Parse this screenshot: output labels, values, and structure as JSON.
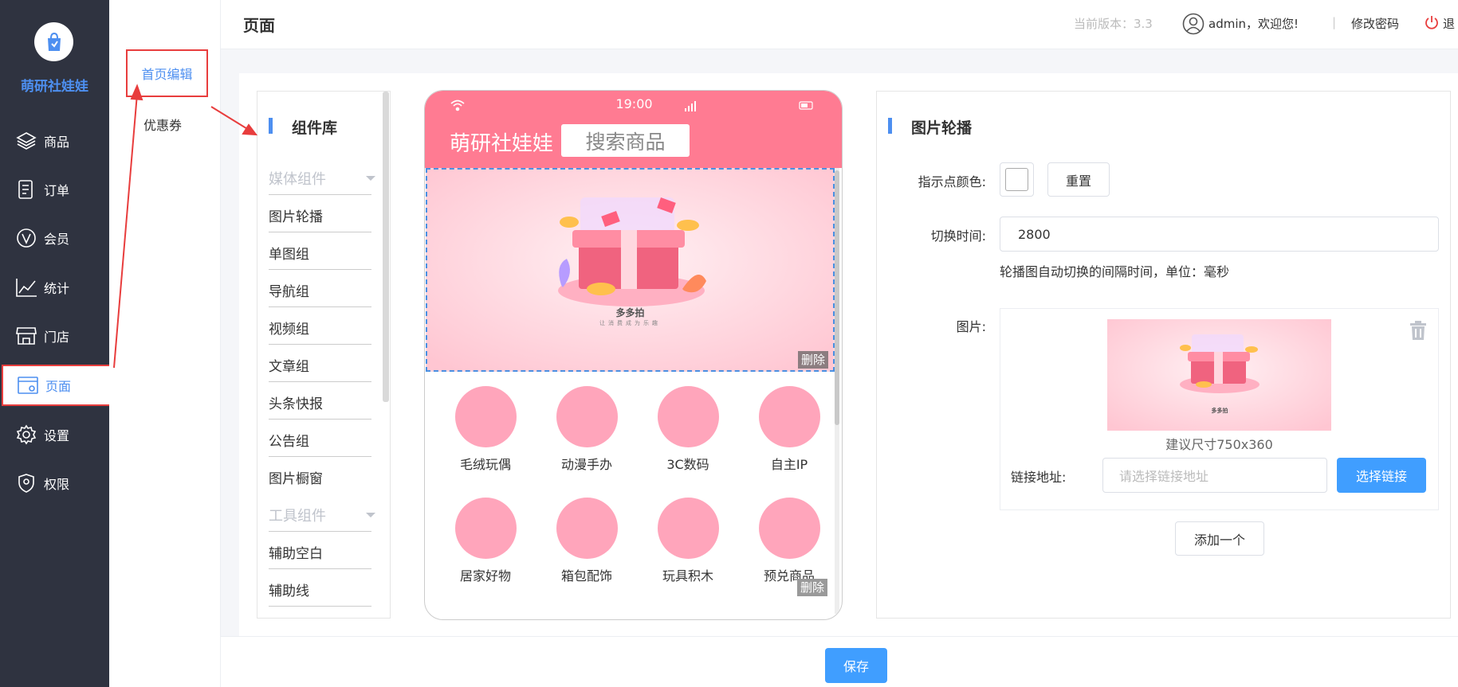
{
  "brand": {
    "name": "萌研社娃娃",
    "logo_icon": "shopping-bag-icon"
  },
  "sidebar": {
    "items": [
      {
        "label": "商品",
        "icon": "layers-icon"
      },
      {
        "label": "订单",
        "icon": "document-icon"
      },
      {
        "label": "会员",
        "icon": "vip-icon"
      },
      {
        "label": "统计",
        "icon": "line-chart-icon"
      },
      {
        "label": "门店",
        "icon": "store-icon"
      },
      {
        "label": "页面",
        "icon": "page-settings-icon",
        "active": true
      },
      {
        "label": "设置",
        "icon": "gear-icon"
      },
      {
        "label": "权限",
        "icon": "shield-icon"
      }
    ]
  },
  "subnav": {
    "items": [
      {
        "label": "首页编辑",
        "active": true
      },
      {
        "label": "优惠券"
      }
    ]
  },
  "header": {
    "title": "页面",
    "version": "当前版本：3.3",
    "user": "admin，欢迎您!",
    "separator": "|",
    "change_password": "修改密码",
    "logout": "退"
  },
  "library": {
    "title": "组件库",
    "groups": [
      {
        "name": "媒体组件",
        "items": [
          "图片轮播",
          "单图组",
          "导航组",
          "视频组",
          "文章组",
          "头条快报",
          "公告组",
          "图片橱窗"
        ]
      },
      {
        "name": "工具组件",
        "items": [
          "辅助空白",
          "辅助线"
        ]
      }
    ]
  },
  "phone": {
    "time": "19:00",
    "brand": "萌研社娃娃",
    "search_placeholder": "搜索商品",
    "banner": {
      "title": "多多拍",
      "subtitle": "让消费成为乐趣"
    },
    "delete_label": "删除",
    "categories": [
      "毛绒玩偶",
      "动漫手办",
      "3C数码",
      "自主IP",
      "居家好物",
      "箱包配饰",
      "玩具积木",
      "预兑商品"
    ]
  },
  "settings": {
    "title": "图片轮播",
    "dot_color_label": "指示点颜色:",
    "reset_label": "重置",
    "interval_label": "切换时间:",
    "interval_value": "2800",
    "interval_hint": "轮播图自动切换的间隔时间，单位：毫秒",
    "image_label": "图片:",
    "size_hint": "建议尺寸750x360",
    "link_label": "链接地址:",
    "link_placeholder": "请选择链接地址",
    "choose_link": "选择链接",
    "add_one": "添加一个"
  },
  "footer": {
    "save": "保存"
  },
  "colors": {
    "accent": "#409eff",
    "sidebar_bg": "#2f3340",
    "phone_pink": "#ff7b92",
    "annotation_red": "#e83d3d"
  }
}
